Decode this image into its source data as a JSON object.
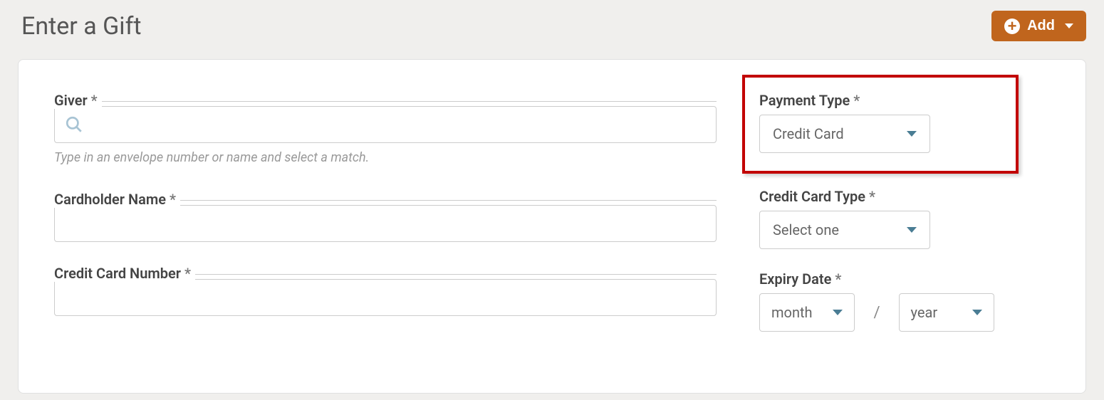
{
  "header": {
    "title": "Enter a Gift",
    "add_label": "Add"
  },
  "form": {
    "giver": {
      "label": "Giver",
      "required": "*",
      "helper": "Type in an envelope number or name and select a match."
    },
    "cardholder": {
      "label": "Cardholder Name",
      "required": "*"
    },
    "card_number": {
      "label": "Credit Card Number",
      "required": "*"
    },
    "payment_type": {
      "label": "Payment Type",
      "required": "*",
      "value": "Credit Card"
    },
    "card_type": {
      "label": "Credit Card Type",
      "required": "*",
      "value": "Select one"
    },
    "expiry": {
      "label": "Expiry Date",
      "required": "*",
      "month": "month",
      "separator": "/",
      "year": "year"
    }
  }
}
